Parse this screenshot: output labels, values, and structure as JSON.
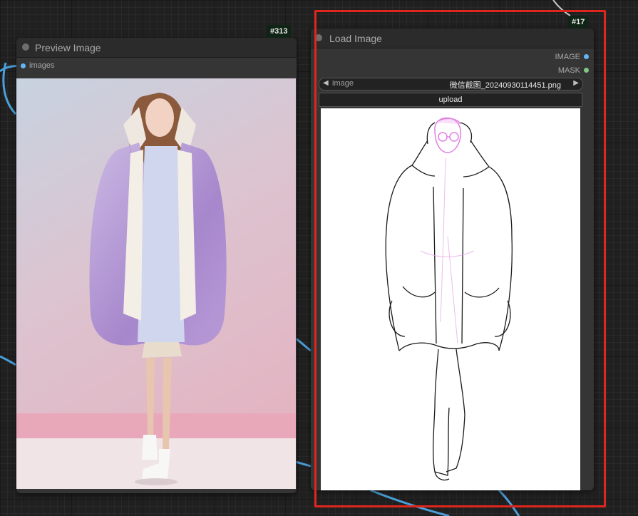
{
  "preview_node": {
    "title": "Preview Image",
    "badge": "#313",
    "input_label": "images"
  },
  "load_node": {
    "title": "Load Image",
    "badge": "#17",
    "outputs": [
      "IMAGE",
      "MASK"
    ],
    "combo_label": "image",
    "combo_value": "微信截图_20240930114451.png",
    "upload_label": "upload"
  },
  "colors": {
    "image_slot": "#64b5f6",
    "mask_slot": "#81c784",
    "link": "#4a9fd8",
    "highlight": "#e0261c"
  },
  "icons": [
    "arrow-left-icon",
    "arrow-right-icon"
  ]
}
